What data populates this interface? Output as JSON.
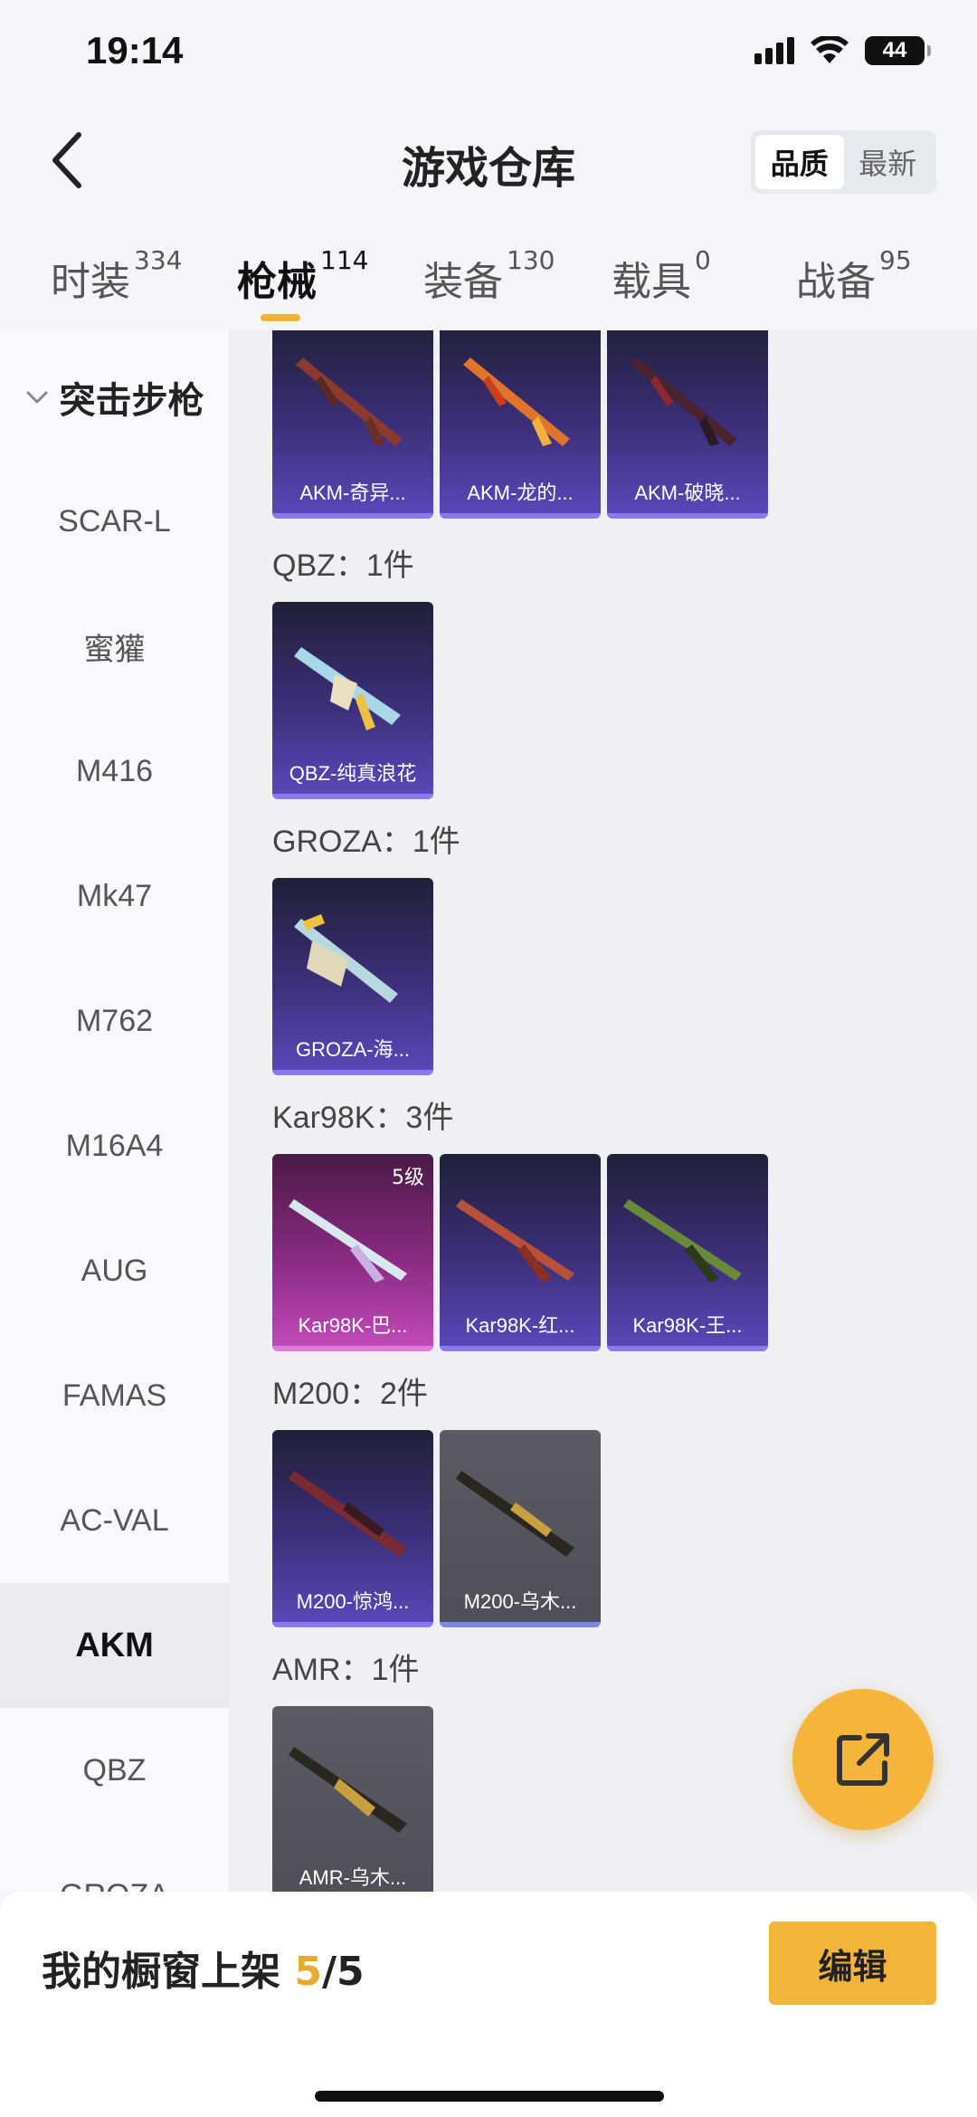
{
  "status": {
    "time": "19:14",
    "battery": "44"
  },
  "header": {
    "title": "游戏仓库",
    "sort_options": [
      "品质",
      "最新"
    ],
    "sort_active": "品质"
  },
  "tabs": [
    {
      "label": "时装",
      "count": "334"
    },
    {
      "label": "枪械",
      "count": "114"
    },
    {
      "label": "装备",
      "count": "130"
    },
    {
      "label": "载具",
      "count": "0"
    },
    {
      "label": "战备",
      "count": "95"
    }
  ],
  "sidebar": {
    "group": "突击步枪",
    "items": [
      "SCAR-L",
      "蜜獾",
      "M416",
      "Mk47",
      "M762",
      "M16A4",
      "AUG",
      "FAMAS",
      "AC-VAL",
      "AKM",
      "QBZ",
      "GROZA"
    ],
    "active": "AKM"
  },
  "content": {
    "akm_cards": [
      "AKM-奇异...",
      "AKM-龙的...",
      "AKM-破晓..."
    ],
    "groups": [
      {
        "label": "QBZ：1件",
        "cards": [
          "QBZ-纯真浪花"
        ]
      },
      {
        "label": "GROZA：1件",
        "cards": [
          "GROZA-海..."
        ]
      },
      {
        "label": "Kar98K：3件",
        "cards": [
          "Kar98K-巴...",
          "Kar98K-红...",
          "Kar98K-王..."
        ],
        "level": "5级"
      },
      {
        "label": "M200：2件",
        "cards": [
          "M200-惊鸿...",
          "M200-乌木..."
        ]
      },
      {
        "label": "AMR：1件",
        "cards": [
          "AMR-乌木..."
        ]
      }
    ]
  },
  "bottom": {
    "showcase_label": "我的橱窗上架",
    "current": "5",
    "total": "/5",
    "edit_label": "编辑"
  },
  "colors": {
    "accent": "#f3b43a",
    "purple_card": "#5a47b8",
    "pink_card": "#c04ab8"
  }
}
